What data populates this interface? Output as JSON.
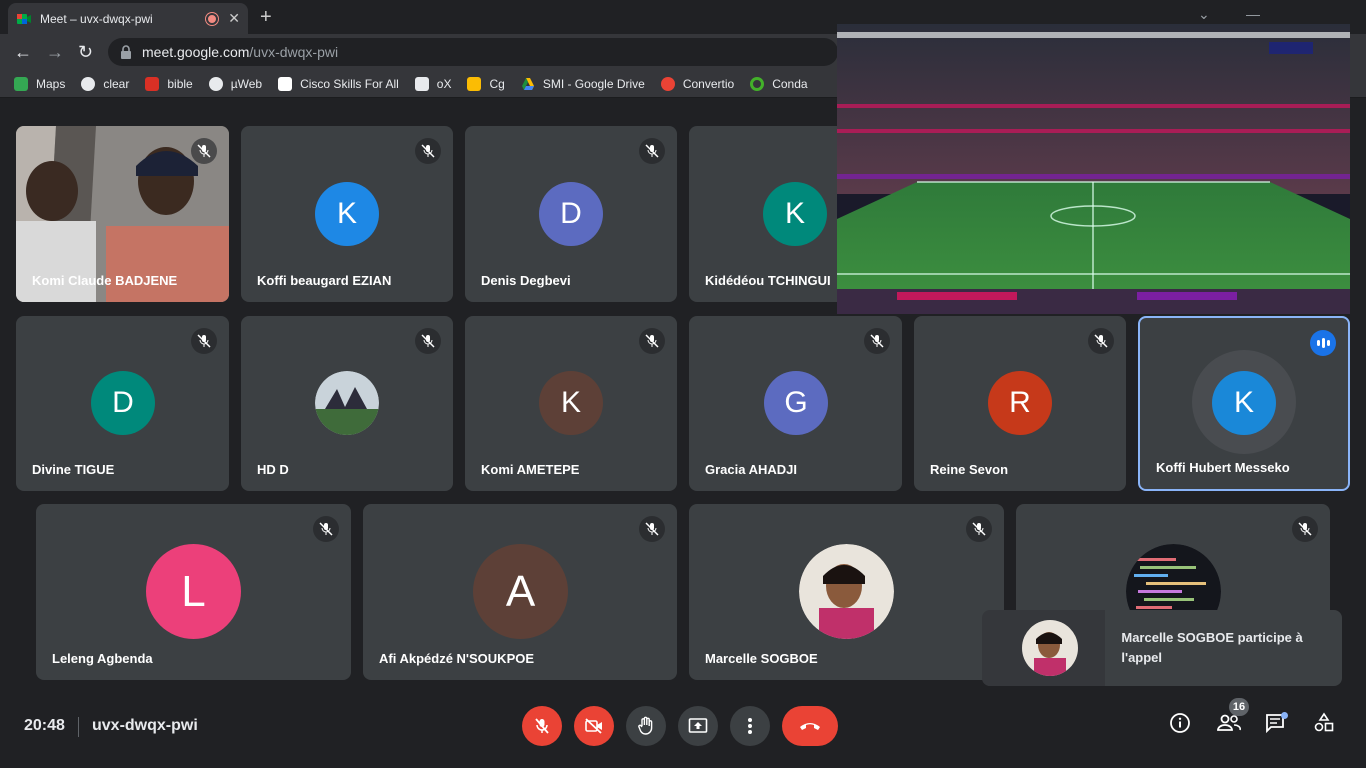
{
  "browser": {
    "tab_title": "Meet – uvx-dwqx-pwi",
    "url_host": "meet.google.com",
    "url_path": "/uvx-dwqx-pwi",
    "bookmarks": [
      {
        "label": "Maps",
        "color": "#34a853"
      },
      {
        "label": "clear",
        "color": "#e8eaed"
      },
      {
        "label": "bible",
        "color": "#d93025"
      },
      {
        "label": "µWeb",
        "color": "#e8eaed"
      },
      {
        "label": "Cisco Skills For All",
        "color": "#ffffff"
      },
      {
        "label": "oX",
        "color": "#e8eaed"
      },
      {
        "label": "Cg",
        "color": "#fbbc04"
      },
      {
        "label": "SMI - Google Drive",
        "color": "#1e8e3e"
      },
      {
        "label": "Convertio",
        "color": "#ea4335"
      },
      {
        "label": "Conda",
        "color": "#43b02a"
      }
    ]
  },
  "participants": [
    {
      "name": "Komi Claude BADJENE"
    },
    {
      "name": "Koffi beaugard EZIAN",
      "initial": "K",
      "color": "#1e88e5"
    },
    {
      "name": "Denis Degbevi",
      "initial": "D",
      "color": "#5c6bc0"
    },
    {
      "name": "Kidédéou TCHINGUI",
      "initial": "K",
      "color": "#00897b"
    },
    {
      "name": "Divine TIGUE",
      "initial": "D",
      "color": "#00897b"
    },
    {
      "name": "HD D"
    },
    {
      "name": "Komi AMETEPE",
      "initial": "K",
      "color": "#5d4037"
    },
    {
      "name": "Gracia AHADJI",
      "initial": "G",
      "color": "#5c6bc0"
    },
    {
      "name": "Reine Sevon",
      "initial": "R",
      "color": "#c6391a"
    },
    {
      "name": "Koffi Hubert Messeko",
      "initial": "K",
      "color": "#1a88d8"
    },
    {
      "name": "Leleng Agbenda",
      "initial": "L",
      "color": "#ec407a"
    },
    {
      "name": "Afi Akpédzé N'SOUKPOE",
      "initial": "A",
      "color": "#5d4037"
    },
    {
      "name": "Marcelle SOGBOE"
    }
  ],
  "toast": {
    "message": "Marcelle SOGBOE participe à l'appel"
  },
  "bottom": {
    "time": "20:48",
    "meeting_code": "uvx-dwqx-pwi",
    "participant_count": "16"
  }
}
